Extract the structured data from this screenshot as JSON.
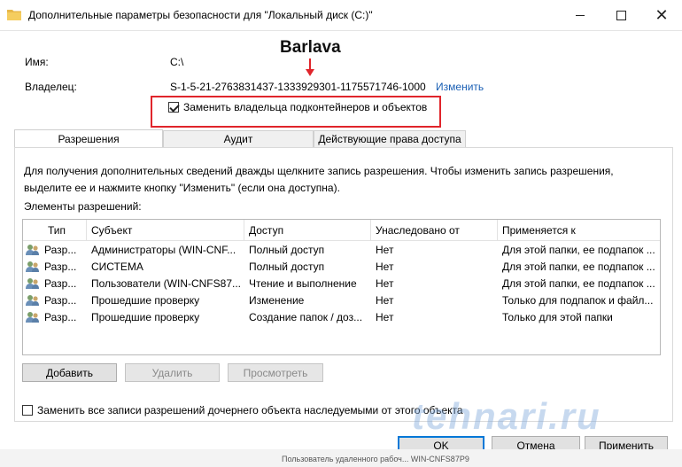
{
  "window": {
    "title": "Дополнительные параметры безопасности  для \"Локальный диск (C:)\"",
    "controls": {
      "minimize": "minimize-icon",
      "maximize": "maximize-icon",
      "close": "✕"
    }
  },
  "name_row": {
    "label": "Имя:",
    "value": "C:\\"
  },
  "owner_row": {
    "label": "Владелец:",
    "value": "S-1-5-21-2763831437-1333929301-1175571746-1000",
    "change_link": "Изменить"
  },
  "replace_owner": {
    "label": "Заменить владельца подконтейнеров и объектов",
    "checked": true
  },
  "annotation": {
    "text": "Barlava",
    "color": "#e0252b"
  },
  "tabs": [
    {
      "label": "Разрешения",
      "active": true
    },
    {
      "label": "Аудит",
      "active": false
    },
    {
      "label": "Действующие права доступа",
      "active": false
    }
  ],
  "info_text": "Для получения дополнительных сведений дважды щелкните запись разрешения. Чтобы изменить запись разрешения, выделите ее и нажмите кнопку \"Изменить\" (если она доступна).",
  "list_label": "Элементы разрешений:",
  "table": {
    "headers": [
      "Тип",
      "Субъект",
      "Доступ",
      "Унаследовано от",
      "Применяется к"
    ],
    "rows": [
      [
        "Разр...",
        "Администраторы (WIN-CNF...",
        "Полный доступ",
        "Нет",
        "Для этой папки, ее подпапок ..."
      ],
      [
        "Разр...",
        "СИСТЕМА",
        "Полный доступ",
        "Нет",
        "Для этой папки, ее подпапок ..."
      ],
      [
        "Разр...",
        "Пользователи (WIN-CNFS87...",
        "Чтение и выполнение",
        "Нет",
        "Для этой папки, ее подпапок ..."
      ],
      [
        "Разр...",
        "Прошедшие проверку",
        "Изменение",
        "Нет",
        "Только для подпапок и файл..."
      ],
      [
        "Разр...",
        "Прошедшие проверку",
        "Создание папок / доз...",
        "Нет",
        "Только для этой папки"
      ]
    ]
  },
  "buttons": {
    "add": "Добавить",
    "remove": "Удалить",
    "view": "Просмотреть",
    "ok": "OK",
    "cancel": "Отмена",
    "apply": "Применить"
  },
  "replace_child": {
    "label": "Заменить все записи разрешений дочернего объекта наследуемыми от этого объекта",
    "checked": false
  },
  "watermark": "tehnari.ru",
  "background_text": "Пользователь удаленного рабоч...   WIN-CNFS87P9"
}
